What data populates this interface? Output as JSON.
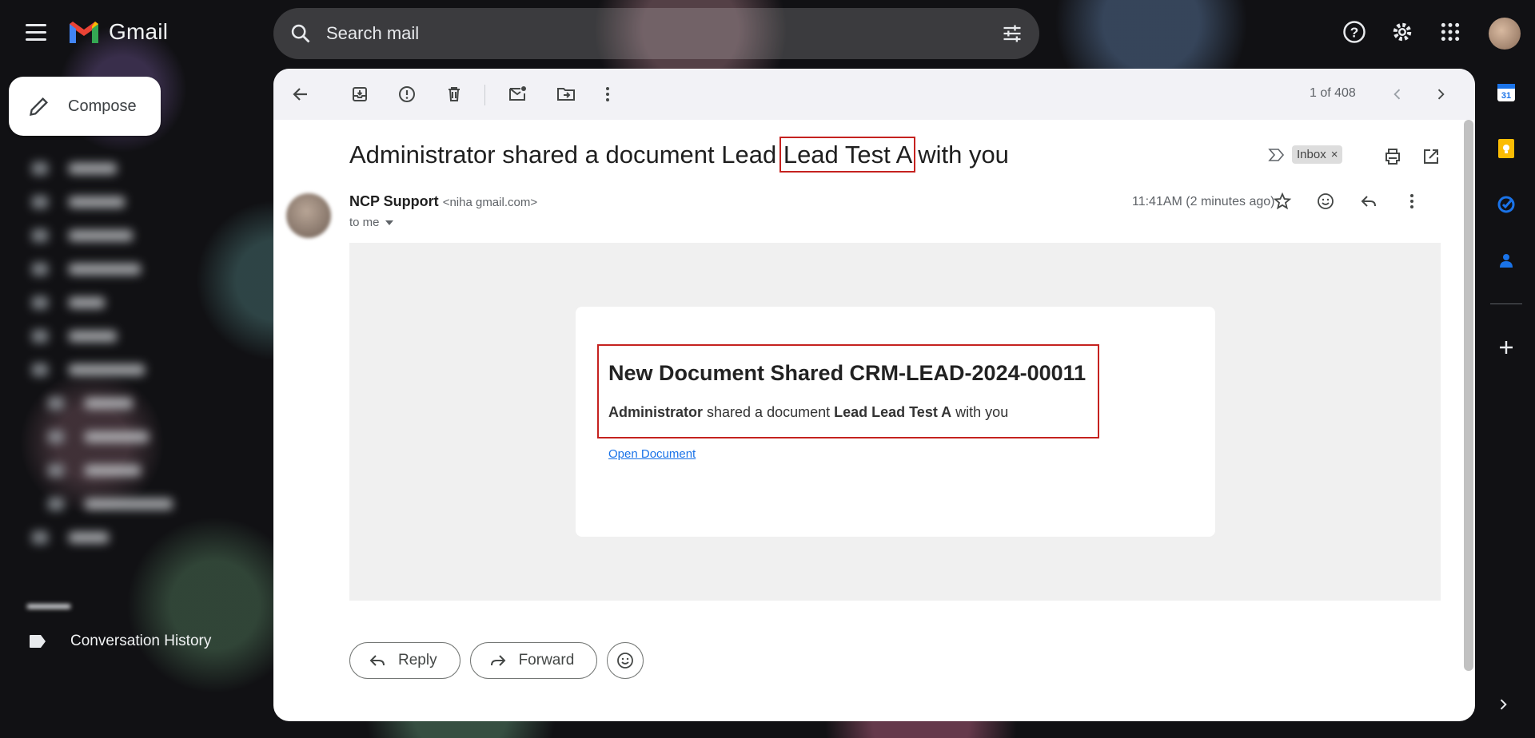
{
  "app": {
    "name": "Gmail"
  },
  "search": {
    "placeholder": "Search mail"
  },
  "compose": {
    "label": "Compose"
  },
  "labels": {
    "items": [
      {
        "label": "Conversation History"
      }
    ]
  },
  "toolbar": {
    "count": "1 of 408"
  },
  "message": {
    "subject_prefix": "Administrator shared a document Lead",
    "subject_highlight": "Lead Test A",
    "subject_suffix": "with you",
    "chip": "Inbox",
    "chip_close": "×",
    "sender_name": "NCP Support",
    "sender_email": "<niha            gmail.com>",
    "to": "to me",
    "time": "11:41AM (2 minutes ago)"
  },
  "body": {
    "heading": "New Document Shared CRM-LEAD-2024-00011",
    "actor": "Administrator",
    "mid": " shared a document ",
    "doc": "Lead Lead Test A",
    "tail": " with you",
    "link": "Open Document"
  },
  "actions": {
    "reply": "Reply",
    "forward": "Forward"
  },
  "colors": {
    "accent": "#c5221f",
    "link": "#1a73e8"
  }
}
